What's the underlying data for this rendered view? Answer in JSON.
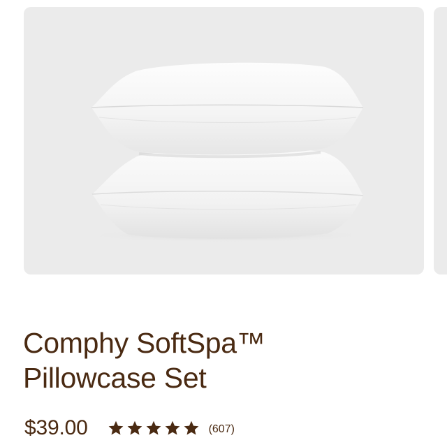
{
  "product": {
    "title_line1": "Comphy SoftSpa™",
    "title_line2": "Pillowcase Set",
    "price": "$39.00",
    "rating": 5,
    "rating_max": 5,
    "review_count": "(607)"
  },
  "image": {
    "subject": "pillow-stack-image"
  },
  "colors": {
    "text": "#4a2a12",
    "star": "#4a2a12",
    "image_background": "#ebebeb"
  }
}
